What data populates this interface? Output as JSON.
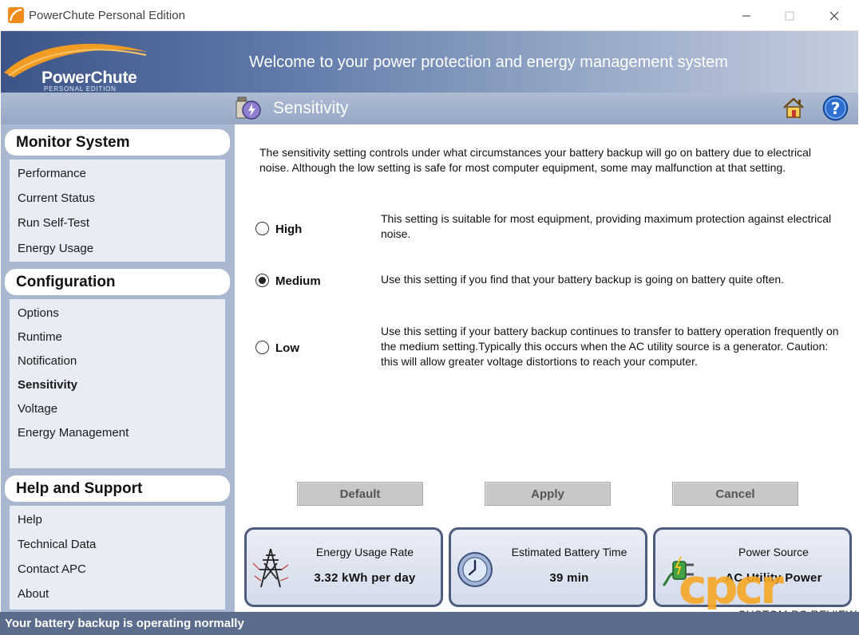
{
  "window": {
    "title": "PowerChute Personal Edition",
    "minimize_icon": "minimize-icon",
    "maximize_icon": "maximize-icon",
    "close_icon": "close-icon"
  },
  "banner": {
    "logo_brand": "PowerChute",
    "logo_edition": "PERSONAL EDITION",
    "welcome": "Welcome to your power protection and energy management system"
  },
  "section": {
    "title": "Sensitivity",
    "icons": [
      "sensitivity-icon",
      "home-icon",
      "help-icon"
    ]
  },
  "sidebar": {
    "groups": [
      {
        "title": "Monitor System",
        "items": [
          "Performance",
          "Current Status",
          "Run Self-Test",
          "Energy Usage"
        ]
      },
      {
        "title": "Configuration",
        "items": [
          "Options",
          "Runtime",
          "Notification",
          "Sensitivity",
          "Voltage",
          "Energy Management"
        ]
      },
      {
        "title": "Help and Support",
        "items": [
          "Help",
          "Technical Data",
          "Contact APC",
          "About"
        ]
      }
    ],
    "active_item": "Sensitivity"
  },
  "main": {
    "intro": "The sensitivity setting controls under what circumstances your battery backup will go on battery due to electrical noise. Although the low setting is safe for most computer equipment, some may malfunction at that setting.",
    "options": [
      {
        "label": "High",
        "checked": false,
        "description": "This setting is suitable for most equipment, providing maximum protection against electrical noise."
      },
      {
        "label": "Medium",
        "checked": true,
        "description": "Use this setting if you find that your battery backup is going on battery quite often."
      },
      {
        "label": "Low",
        "checked": false,
        "description": "Use this setting if your battery backup continues to transfer to battery operation frequently on the medium setting.Typically this occurs when the AC utility source is a generator. Caution: this will allow greater voltage distortions to reach your computer."
      }
    ],
    "buttons": {
      "default": "Default",
      "apply": "Apply",
      "cancel": "Cancel"
    }
  },
  "cards": [
    {
      "title": "Energy Usage Rate",
      "value": "3.32 kWh per day",
      "icon": "power-tower-icon"
    },
    {
      "title": "Estimated Battery Time",
      "value": "39 min",
      "icon": "clock-icon"
    },
    {
      "title": "Power Source",
      "value": "AC Utility Power",
      "icon": "plug-icon"
    }
  ],
  "status": {
    "text": "Your battery backup is operating normally"
  },
  "watermark": {
    "logo": "CPCR",
    "text": "CUSTOM PC REVIEW"
  },
  "colors": {
    "banner_dark": "#3d5488",
    "sidebar": "#a9b7cf",
    "status_bar": "#5b6c8c",
    "card_border": "#4d5c7b",
    "watermark_orange": "#f5a623"
  }
}
